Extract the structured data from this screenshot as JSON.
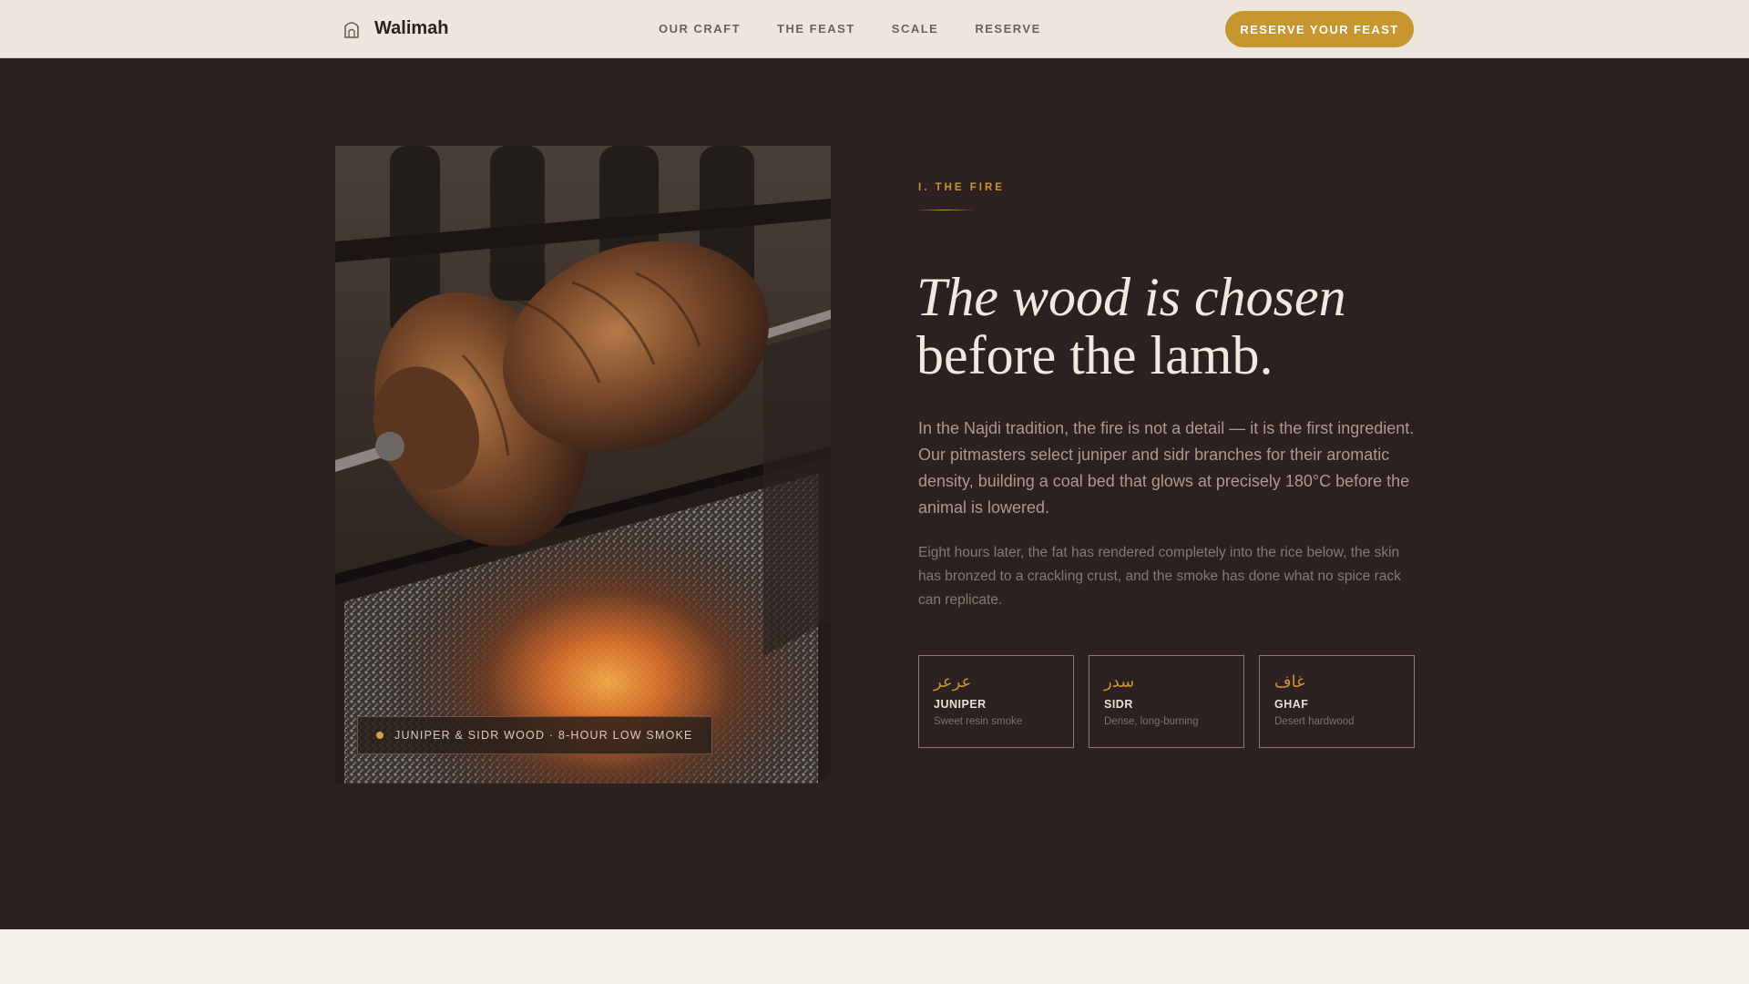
{
  "nav": {
    "brand_name": "Walimah",
    "links": [
      "OUR CRAFT",
      "THE FEAST",
      "SCALE",
      "RESERVE"
    ],
    "cta_label": "RESERVE YOUR FEAST",
    "accent_color": "#c8962e"
  },
  "hero_image": {
    "caption": "JUNIPER & SIDR WOOD · 8-HOUR LOW SMOKE"
  },
  "section": {
    "eyebrow": "I. THE FIRE",
    "headline_line1": "The wood is chosen",
    "headline_line2": "before the lamb.",
    "lead": "In the Najdi tradition, the fire is not a detail — it is the first ingredient. Our pitmasters select juniper and sidr branches for their aromatic density, building a coal bed that glows at precisely 180°C before the animal is lowered.",
    "body": "Eight hours later, the fat has rendered completely into the rice below, the skin has bronzed to a crackling crust, and the smoke has done what no spice rack can replicate."
  },
  "woods": [
    {
      "arabic": "عرعر",
      "name": "JUNIPER",
      "note": "Sweet resin smoke"
    },
    {
      "arabic": "سدر",
      "name": "SIDR",
      "note": "Dense, long-burning"
    },
    {
      "arabic": "غاف",
      "name": "GHAF",
      "note": "Desert hardwood"
    }
  ],
  "icons": {
    "brand": "tent-icon",
    "caption_dot": "dot-icon"
  },
  "colors": {
    "background": "#2c2120",
    "nav_background": "#ede6df",
    "accent": "#c8962e"
  }
}
